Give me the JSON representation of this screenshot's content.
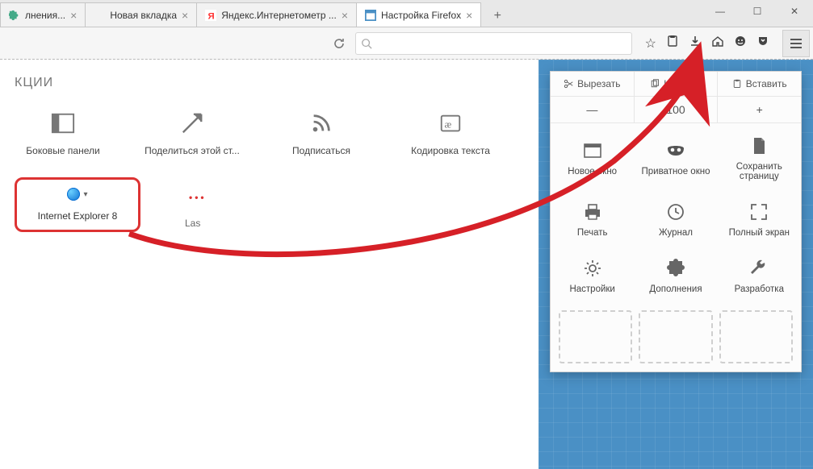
{
  "window": {
    "minimize": "—",
    "maximize": "☐",
    "close": "✕"
  },
  "tabs": [
    {
      "label": "лнения...",
      "favicon": "puzzle"
    },
    {
      "label": "Новая вкладка",
      "favicon": ""
    },
    {
      "label": "Яндекс.Интернетометр ...",
      "favicon": "yandex"
    },
    {
      "label": "Настройка Firefox",
      "favicon": "box",
      "active": true
    }
  ],
  "newtab": "+",
  "toolbar": {
    "search_placeholder": "",
    "icons": {
      "star": "☆",
      "clipboard": "📋",
      "download": "⬇",
      "home": "⌂",
      "smile": "☻",
      "pocket": "▾"
    }
  },
  "leftpane": {
    "title": "КЦИИ",
    "tools": [
      {
        "key": "sidebars",
        "label": "Боковые панели"
      },
      {
        "key": "share",
        "label": "Поделиться этой ст..."
      },
      {
        "key": "subscribe",
        "label": "Подписаться"
      },
      {
        "key": "encoding",
        "label": "Кодировка текста"
      }
    ],
    "ie_label": "Internet Explorer 8",
    "lastpass_dots": "•••",
    "lastpass_cut": "Las"
  },
  "panel": {
    "edit": {
      "cut": "Вырезать",
      "copy": "Копиров",
      "paste": "Вставить"
    },
    "zoom": {
      "minus": "—",
      "value": "100",
      "plus": "+"
    },
    "items": [
      {
        "key": "newwindow",
        "label": "Новое окно"
      },
      {
        "key": "private",
        "label": "Приватное окно"
      },
      {
        "key": "savepage",
        "label": "Сохранить страницу"
      },
      {
        "key": "print",
        "label": "Печать"
      },
      {
        "key": "history",
        "label": "Журнал"
      },
      {
        "key": "fullscreen",
        "label": "Полный экран"
      },
      {
        "key": "settings",
        "label": "Настройки"
      },
      {
        "key": "addons",
        "label": "Дополнения"
      },
      {
        "key": "developer",
        "label": "Разработка"
      }
    ]
  }
}
